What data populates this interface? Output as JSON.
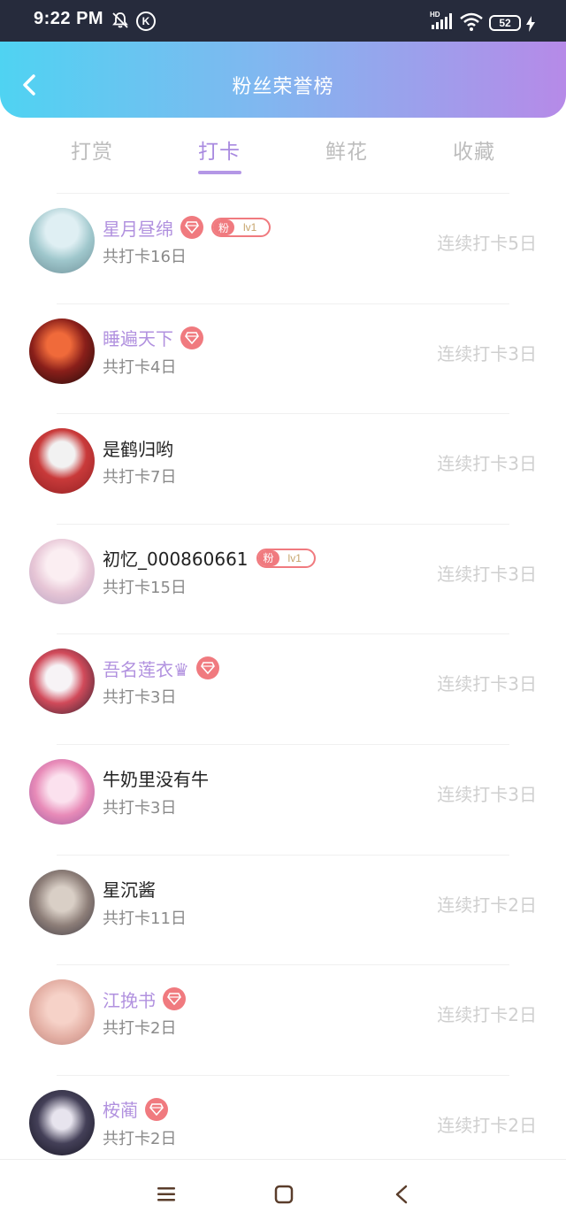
{
  "status_bar": {
    "time": "9:22 PM",
    "k_label": "K",
    "battery": "52"
  },
  "header": {
    "title": "粉丝荣誉榜"
  },
  "tabs": [
    {
      "label": "打赏",
      "active": false
    },
    {
      "label": "打卡",
      "active": true
    },
    {
      "label": "鲜花",
      "active": false
    },
    {
      "label": "收藏",
      "active": false
    }
  ],
  "fan_badge": {
    "prefix": "粉",
    "level": "lv1"
  },
  "colors": {
    "accent": "#b191df",
    "badge": "#f07a7f"
  },
  "list": [
    {
      "name": "星月昼绵",
      "vip": true,
      "diamond": true,
      "fan_badge": true,
      "total": "共打卡16日",
      "streak": "连续打卡5日"
    },
    {
      "name": "睡遍天下",
      "vip": true,
      "diamond": true,
      "fan_badge": false,
      "total": "共打卡4日",
      "streak": "连续打卡3日"
    },
    {
      "name": "是鹤归哟",
      "vip": false,
      "diamond": false,
      "fan_badge": false,
      "total": "共打卡7日",
      "streak": "连续打卡3日"
    },
    {
      "name": "初忆_000860661",
      "vip": false,
      "diamond": false,
      "fan_badge": true,
      "total": "共打卡15日",
      "streak": "连续打卡3日"
    },
    {
      "name": "吾名莲衣♛",
      "vip": true,
      "diamond": true,
      "fan_badge": false,
      "total": "共打卡3日",
      "streak": "连续打卡3日"
    },
    {
      "name": "牛奶里没有牛",
      "vip": false,
      "diamond": false,
      "fan_badge": false,
      "total": "共打卡3日",
      "streak": "连续打卡3日"
    },
    {
      "name": "星沉酱",
      "vip": false,
      "diamond": false,
      "fan_badge": false,
      "total": "共打卡11日",
      "streak": "连续打卡2日"
    },
    {
      "name": "江挽书",
      "vip": true,
      "diamond": true,
      "fan_badge": false,
      "total": "共打卡2日",
      "streak": "连续打卡2日"
    },
    {
      "name": "桉蔺",
      "vip": true,
      "diamond": true,
      "fan_badge": false,
      "total": "共打卡2日",
      "streak": "连续打卡2日"
    }
  ]
}
